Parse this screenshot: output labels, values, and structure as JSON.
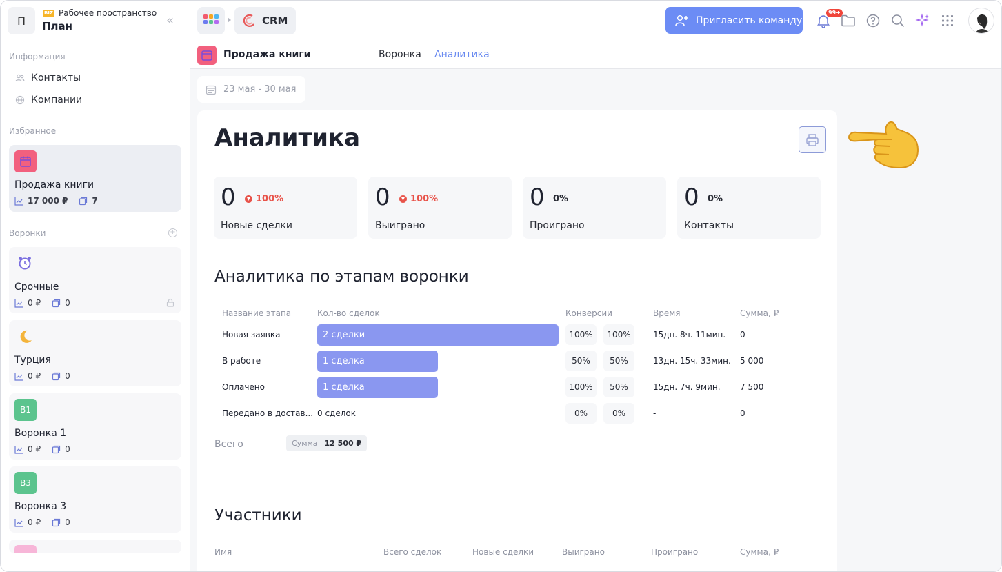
{
  "workspace": {
    "avatar_letter": "П",
    "biz_badge": "BIZ",
    "label": "Рабочее пространство",
    "name": "План"
  },
  "sidebar": {
    "info_title": "Информация",
    "info_items": [
      {
        "label": "Контакты",
        "icon": "contacts-icon"
      },
      {
        "label": "Компании",
        "icon": "companies-icon"
      }
    ],
    "favorites_title": "Избранное",
    "favorite": {
      "name": "Продажа книги",
      "sum": "17 000 ₽",
      "count": "7"
    },
    "funnels_title": "Воронки",
    "funnels": [
      {
        "name": "Срочные",
        "sum": "0 ₽",
        "count": "0",
        "icon": "alarm-clock-icon",
        "locked": true
      },
      {
        "name": "Турция",
        "sum": "0 ₽",
        "count": "0",
        "icon": "crescent-moon-icon"
      },
      {
        "name": "Воронка 1",
        "sum": "0 ₽",
        "count": "0",
        "tile": "В1",
        "tile_color": "#5cc48e"
      },
      {
        "name": "Воронка 3",
        "sum": "0 ₽",
        "count": "0",
        "tile": "В3",
        "tile_color": "#5cc48e"
      }
    ]
  },
  "topbar": {
    "app_name": "CRM",
    "invite_label": "Пригласить команду",
    "notif_badge": "99+"
  },
  "subheader": {
    "title": "Продажа книги",
    "tabs": [
      "Воронка",
      "Аналитика"
    ],
    "active_tab": 1
  },
  "date_range": "23 мая - 30 мая",
  "analytics": {
    "title": "Аналитика",
    "kpis": [
      {
        "value": "0",
        "delta": "100%",
        "trend": "down",
        "label": "Новые сделки"
      },
      {
        "value": "0",
        "delta": "100%",
        "trend": "down",
        "label": "Выиграно"
      },
      {
        "value": "0",
        "delta": "0%",
        "trend": "flat",
        "label": "Проиграно"
      },
      {
        "value": "0",
        "delta": "0%",
        "trend": "flat",
        "label": "Контакты"
      }
    ],
    "stages_title": "Аналитика по этапам воронки",
    "stage_headers": [
      "Название этапа",
      "Кол-во сделок",
      "Конверсии",
      "Время",
      "Сумма, ₽"
    ],
    "stages": [
      {
        "name": "Новая заявка",
        "deals_label": "2 сделки",
        "deals": 2,
        "conv1": "100%",
        "conv2": "100%",
        "time": "15дн. 8ч. 11мин.",
        "sum": "0"
      },
      {
        "name": "В работе",
        "deals_label": "1 сделка",
        "deals": 1,
        "conv1": "50%",
        "conv2": "50%",
        "time": "13дн. 15ч. 33мин.",
        "sum": "5 000"
      },
      {
        "name": "Оплачено",
        "deals_label": "1 сделка",
        "deals": 1,
        "conv1": "100%",
        "conv2": "50%",
        "time": "15дн. 7ч. 9мин.",
        "sum": "7 500"
      },
      {
        "name": "Передано в достав...",
        "deals_label": "0 сделок",
        "deals": 0,
        "conv1": "0%",
        "conv2": "0%",
        "time": "-",
        "sum": "0"
      }
    ],
    "total_label": "Всего",
    "total_sum_key": "Сумма",
    "total_sum_value": "12 500 ₽",
    "participants_title": "Участники",
    "participant_headers": [
      "Имя",
      "Всего сделок",
      "Новые сделки",
      "Выиграно",
      "Проиграно",
      "Сумма, ₽"
    ]
  },
  "colors": {
    "accent": "#6c8cf5",
    "bar": "#8a97f0",
    "negative": "#e8534a",
    "favorite_tile": "#f2607e"
  }
}
